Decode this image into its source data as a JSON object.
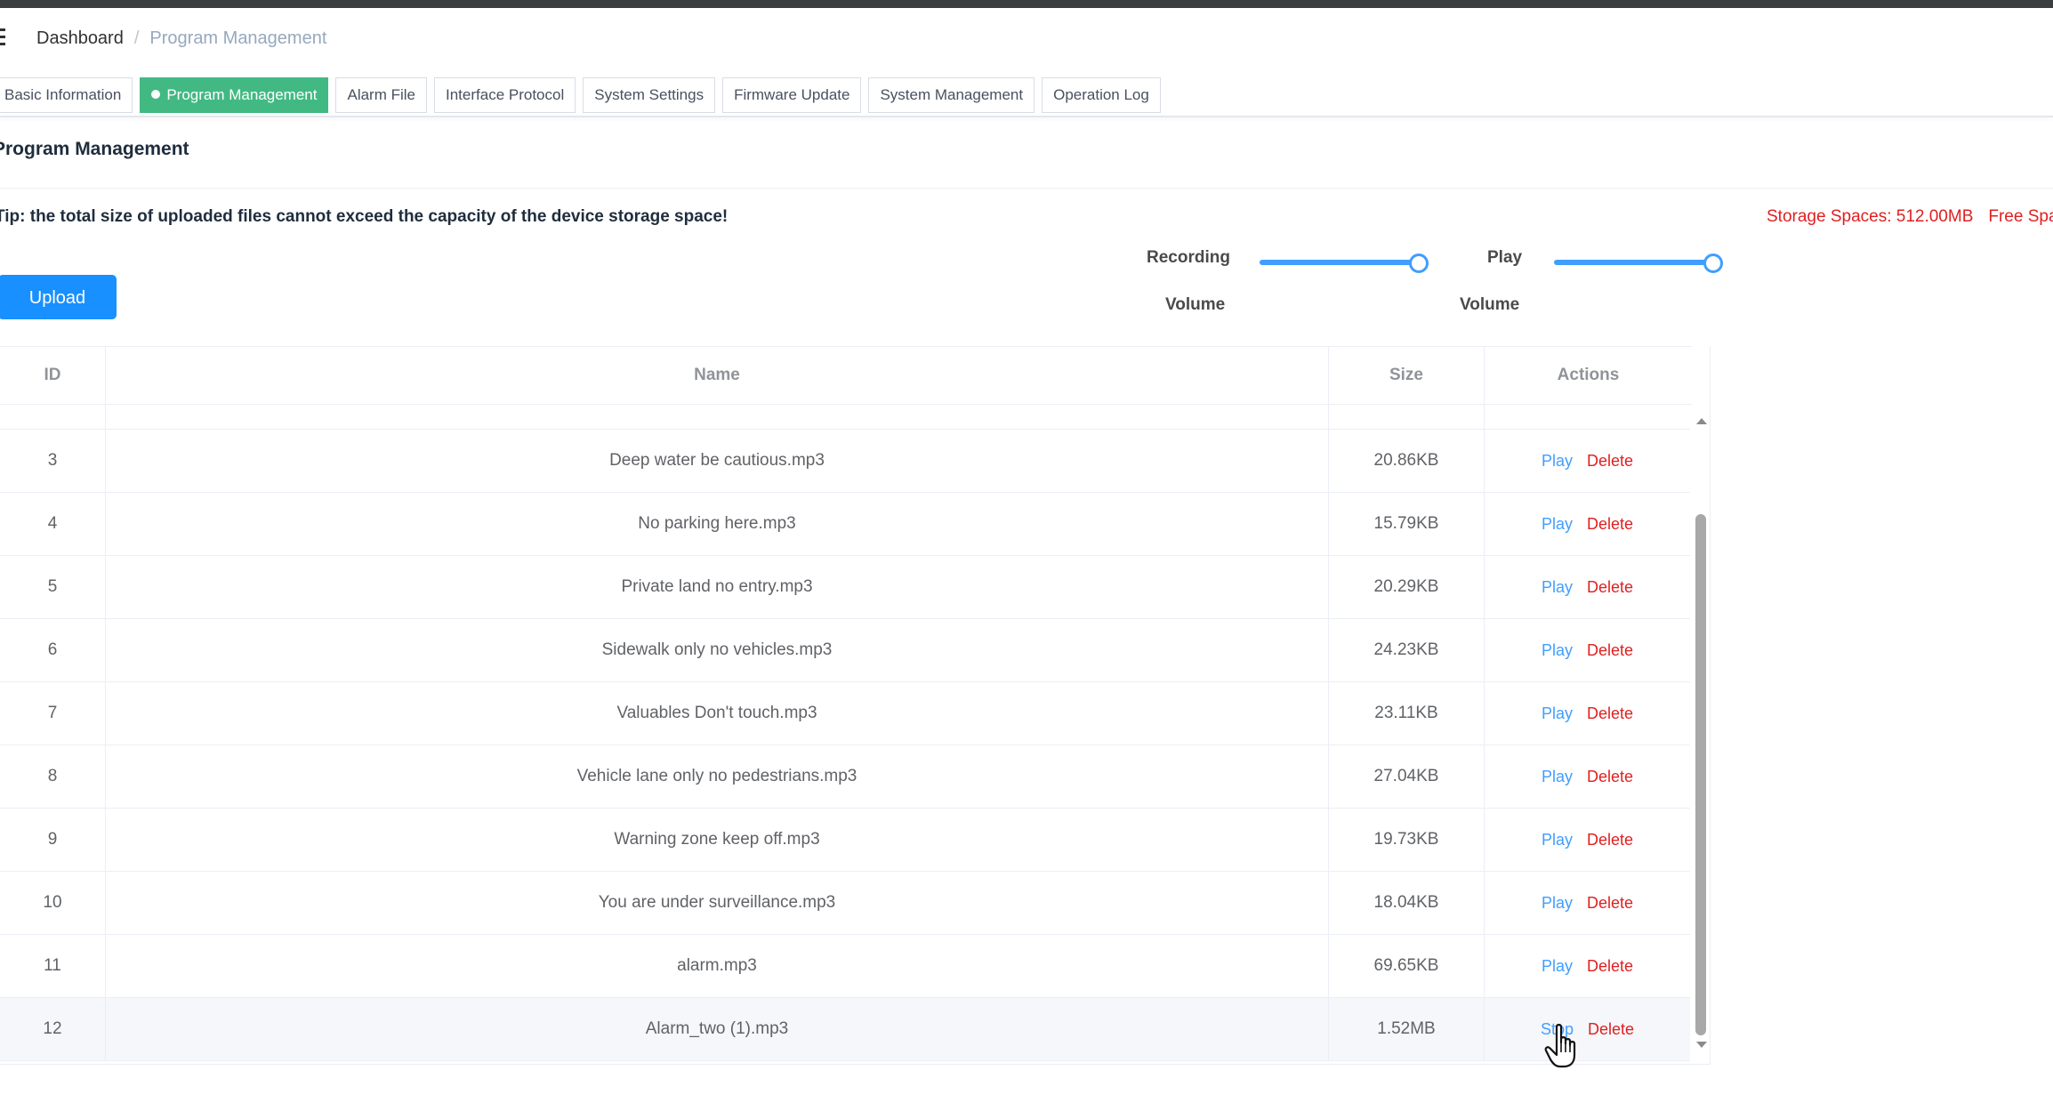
{
  "breadcrumb": {
    "home": "Dashboard",
    "separator": "/",
    "current": "Program Management"
  },
  "tabs": [
    {
      "label": "Basic Information",
      "active": false
    },
    {
      "label": "Program Management",
      "active": true
    },
    {
      "label": "Alarm File",
      "active": false
    },
    {
      "label": "Interface Protocol",
      "active": false
    },
    {
      "label": "System Settings",
      "active": false
    },
    {
      "label": "Firmware Update",
      "active": false
    },
    {
      "label": "System Management",
      "active": false
    },
    {
      "label": "Operation Log",
      "active": false
    }
  ],
  "page": {
    "title": "Program Management",
    "tip": "Tip: the total size of uploaded files cannot exceed the capacity of the device storage space!",
    "storage_spaces": "Storage Spaces: 512.00MB",
    "free_space": "Free Space"
  },
  "upload_label": "Upload",
  "volume": {
    "recording": {
      "label_line1": "Recording",
      "label_line2": "Volume",
      "level": 1.0
    },
    "play": {
      "label_line1": "Play",
      "label_line2": "Volume",
      "level": 1.0
    }
  },
  "table": {
    "columns": [
      "ID",
      "Name",
      "Size",
      "Actions"
    ],
    "rows": [
      {
        "id": "",
        "name": "",
        "size": "",
        "play": "",
        "delete": ""
      },
      {
        "id": "3",
        "name": "Deep water be cautious.mp3",
        "size": "20.86KB",
        "play": "Play",
        "delete": "Delete"
      },
      {
        "id": "4",
        "name": "No parking here.mp3",
        "size": "15.79KB",
        "play": "Play",
        "delete": "Delete"
      },
      {
        "id": "5",
        "name": "Private land no entry.mp3",
        "size": "20.29KB",
        "play": "Play",
        "delete": "Delete"
      },
      {
        "id": "6",
        "name": "Sidewalk only no vehicles.mp3",
        "size": "24.23KB",
        "play": "Play",
        "delete": "Delete"
      },
      {
        "id": "7",
        "name": "Valuables Don't touch.mp3",
        "size": "23.11KB",
        "play": "Play",
        "delete": "Delete"
      },
      {
        "id": "8",
        "name": "Vehicle lane only no pedestrians.mp3",
        "size": "27.04KB",
        "play": "Play",
        "delete": "Delete"
      },
      {
        "id": "9",
        "name": "Warning zone keep off.mp3",
        "size": "19.73KB",
        "play": "Play",
        "delete": "Delete"
      },
      {
        "id": "10",
        "name": "You are under surveillance.mp3",
        "size": "18.04KB",
        "play": "Play",
        "delete": "Delete"
      },
      {
        "id": "11",
        "name": "alarm.mp3",
        "size": "69.65KB",
        "play": "Play",
        "delete": "Delete"
      },
      {
        "id": "12",
        "name": "Alarm_two (1).mp3",
        "size": "1.52MB",
        "play": "Stop",
        "delete": "Delete"
      }
    ]
  }
}
